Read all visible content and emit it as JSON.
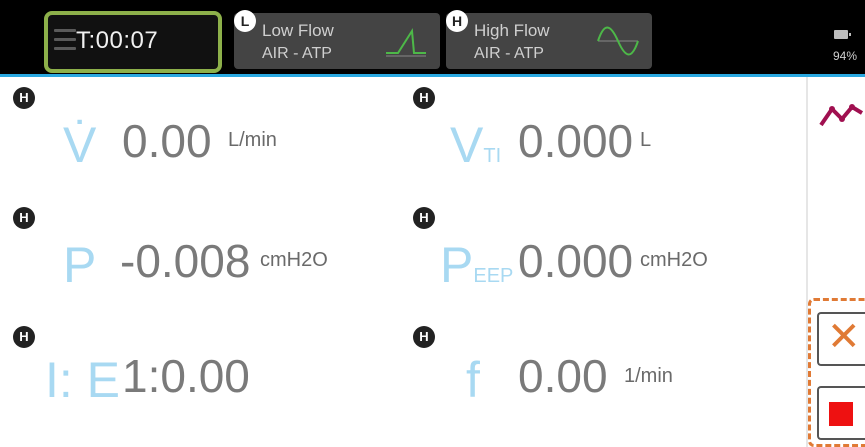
{
  "header": {
    "timer": "T:00:07",
    "modes": [
      {
        "badge": "L",
        "name": "Low Flow",
        "gas": "AIR - ATP",
        "wave_icon": "ramp-wave-icon"
      },
      {
        "badge": "H",
        "name": "High Flow",
        "gas": "AIR - ATP",
        "wave_icon": "sine-wave-icon"
      }
    ],
    "battery": "94%"
  },
  "measurements": [
    {
      "badge": "H",
      "symbol": "V̇",
      "value": "0.00",
      "unit": "L/min"
    },
    {
      "badge": "H",
      "symbol": "V",
      "symbol_sub": "TI",
      "value": "0.000",
      "unit": "L"
    },
    {
      "badge": "H",
      "symbol": "P",
      "value": "-0.008",
      "unit": "cmH2O"
    },
    {
      "badge": "H",
      "symbol": "P",
      "symbol_sub": "EEP",
      "value": "0.000",
      "unit": "cmH2O"
    },
    {
      "badge": "H",
      "symbol": "I: E",
      "value": "1:0.00",
      "unit": ""
    },
    {
      "badge": "H",
      "symbol": "f",
      "value": "0.00",
      "unit": "1/min"
    }
  ],
  "side": {
    "cancel_glyph": "✕",
    "colors": {
      "accent": "#e07a35",
      "stop": "#ee1111",
      "trend": "#a01050",
      "highlight": "#8db04a",
      "symbol": "#a8d9f2"
    }
  }
}
